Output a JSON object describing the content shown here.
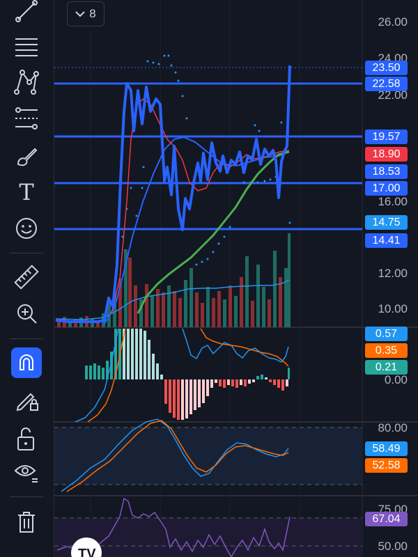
{
  "toolbar": {
    "tools": [
      {
        "name": "trend-line-icon"
      },
      {
        "name": "fib-retracement-icon"
      },
      {
        "name": "patterns-icon"
      },
      {
        "name": "prediction-icon"
      },
      {
        "name": "brush-icon"
      },
      {
        "name": "text-icon",
        "glyph": "T"
      },
      {
        "name": "emoji-icon"
      },
      {
        "name": "ruler-icon"
      },
      {
        "name": "zoom-in-icon"
      },
      {
        "name": "magnet-icon"
      },
      {
        "name": "lock-drawing-icon"
      },
      {
        "name": "unlock-icon"
      },
      {
        "name": "eye-icon"
      },
      {
        "name": "trash-icon"
      }
    ]
  },
  "header": {
    "indicator_count": "8"
  },
  "price_axis": {
    "labels": [
      "26.00",
      "24.00",
      "22.00",
      "16.00",
      "12.00",
      "10.00"
    ]
  },
  "price_tags": [
    {
      "value": "23.50",
      "bg": "#2962ff"
    },
    {
      "value": "22.58",
      "bg": "#2962ff"
    },
    {
      "value": "19.57",
      "bg": "#2962ff"
    },
    {
      "value": "18.90",
      "bg": "#f23645"
    },
    {
      "value": "18.53",
      "bg": "#2962ff"
    },
    {
      "value": "17.00",
      "bg": "#2962ff"
    },
    {
      "value": "14.75",
      "bg": "#2196f3"
    },
    {
      "value": "14.41",
      "bg": "#2962ff"
    }
  ],
  "macd": {
    "tags": [
      {
        "value": "0.57",
        "bg": "#2196f3"
      },
      {
        "value": "0.35",
        "bg": "#ff6d00"
      },
      {
        "value": "0.21",
        "bg": "#26a69a"
      }
    ],
    "zero_label": "0.00"
  },
  "stoch": {
    "top_label": "80.00",
    "tags": [
      {
        "value": "58.49",
        "bg": "#2196f3"
      },
      {
        "value": "52.58",
        "bg": "#ff6d00"
      }
    ]
  },
  "rsi": {
    "top_label": "75.00",
    "bottom_label": "50.00",
    "tag": {
      "value": "67.04",
      "bg": "#7e57c2"
    }
  },
  "colors": {
    "background": "#131722",
    "accent": "#2962ff",
    "up": "#26a69a",
    "down": "#ef5350"
  }
}
